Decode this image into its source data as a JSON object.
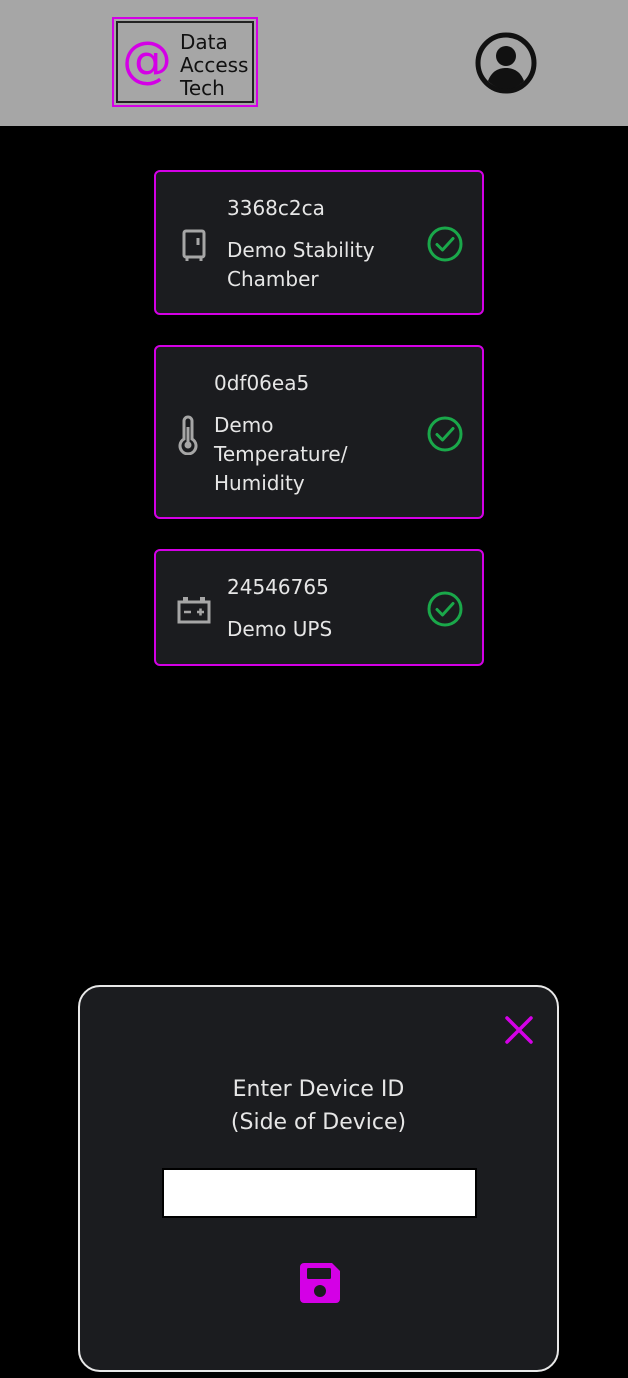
{
  "header": {
    "logo": {
      "at_symbol": "@",
      "lines": [
        "Data",
        "Access",
        "Tech"
      ]
    },
    "profile_icon": "user-circle-icon"
  },
  "devices": [
    {
      "id": "3368c2ca",
      "name": "Demo Stability\nChamber",
      "icon": "refrigerator-icon",
      "status_icon": "check-circle-icon",
      "status": "ok"
    },
    {
      "id": "0df06ea5",
      "name": "Demo\nTemperature/\nHumidity",
      "icon": "thermometer-icon",
      "status_icon": "check-circle-icon",
      "status": "ok"
    },
    {
      "id": "24546765",
      "name": "Demo UPS",
      "icon": "battery-icon",
      "status_icon": "check-circle-icon",
      "status": "ok"
    }
  ],
  "modal": {
    "title_line1": "Enter Device ID",
    "title_line2": "(Side of Device)",
    "input_value": "",
    "input_placeholder": "",
    "close_icon": "close-icon",
    "save_icon": "save-icon"
  },
  "colors": {
    "accent": "#d400e6",
    "header_bg": "#a6a6a6",
    "card_bg": "#1b1c1f",
    "status_ok": "#1aa84a",
    "icon_gray": "#a6a6a6"
  }
}
